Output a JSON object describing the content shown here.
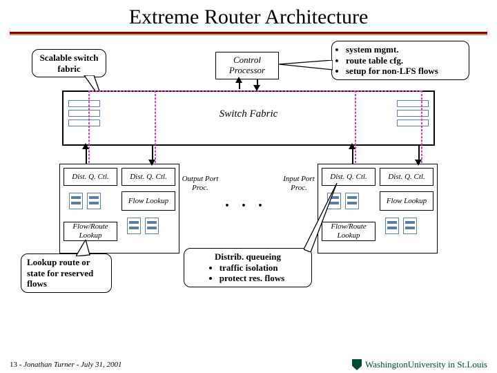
{
  "title": "Extreme Router Architecture",
  "callouts": {
    "scalable": "Scalable switch fabric",
    "sysmgmt": {
      "items": [
        "system mgmt.",
        "route table cfg.",
        "setup for non-LFS flows"
      ]
    },
    "distq": {
      "heading": "Distrib. queueing",
      "items": [
        "traffic isolation",
        "protect res. flows"
      ]
    },
    "lookup": "Lookup route or state for reserved flows"
  },
  "blocks": {
    "control_processor": "Control Processor",
    "switch_fabric": "Switch Fabric",
    "dist_q_ctl": "Dist. Q. Ctl.",
    "flow_lookup": "Flow Lookup",
    "flow_route_lookup": "Flow/Route Lookup",
    "output_port_proc": "Output Port Proc.",
    "input_port_proc": "Input Port Proc."
  },
  "footer": {
    "page": "13",
    "sep": " - ",
    "author_date": "Jonathan Turner - July 31, 2001"
  },
  "logo": {
    "text": "WashingtonUniversity in St.Louis"
  }
}
